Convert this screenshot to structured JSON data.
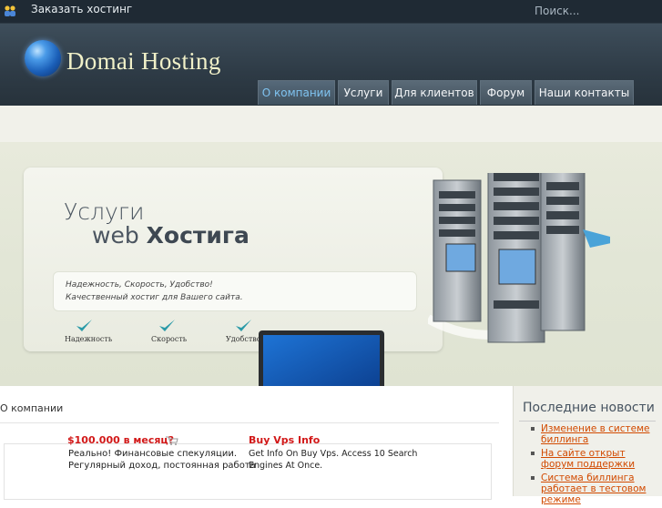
{
  "topbar": {
    "order_label": "Заказать хостинг",
    "search_placeholder": "Поиск..."
  },
  "header": {
    "logo_text": "Domai Hosting"
  },
  "nav": {
    "items": [
      {
        "label": "О компании",
        "active": true
      },
      {
        "label": "Услуги",
        "active": false
      },
      {
        "label": "Для клиентов",
        "active": false
      },
      {
        "label": "Форум",
        "active": false
      },
      {
        "label": "Наши контакты",
        "active": false
      }
    ]
  },
  "banner": {
    "title_line1": "Услуги",
    "title_line2_a": "web",
    "title_line2_b": "Хостига",
    "line1": "Надежность, Скорость, Удобство!",
    "line2": "Качественный хостиг для Вашего сайта.",
    "features": [
      "Надежность",
      "Скорость",
      "Удобство"
    ]
  },
  "content": {
    "breadcrumb": "О компании",
    "ads": [
      {
        "title": "$100.000 в месяц?",
        "text1": "Реально! Финансовые спекуляции.",
        "text2": "Регулярный доход, постоянная работа"
      },
      {
        "title": "Buy Vps Info",
        "text1": "Get Info On Buy Vps. Access 10 Search",
        "text2": "Engines At Once."
      }
    ]
  },
  "sidebar": {
    "news_title": "Последние новости",
    "news": [
      "Изменение в системе биллинга",
      "На сайте открыт форум поддержки",
      "Система биллинга работает в тестовом режиме"
    ]
  },
  "colors": {
    "topbar_bg": "#1f2a34",
    "header_bg": "#2e3b46",
    "nav_active_text": "#7fc3f0",
    "ad_title": "#d21818",
    "news_link": "#d24a00"
  }
}
